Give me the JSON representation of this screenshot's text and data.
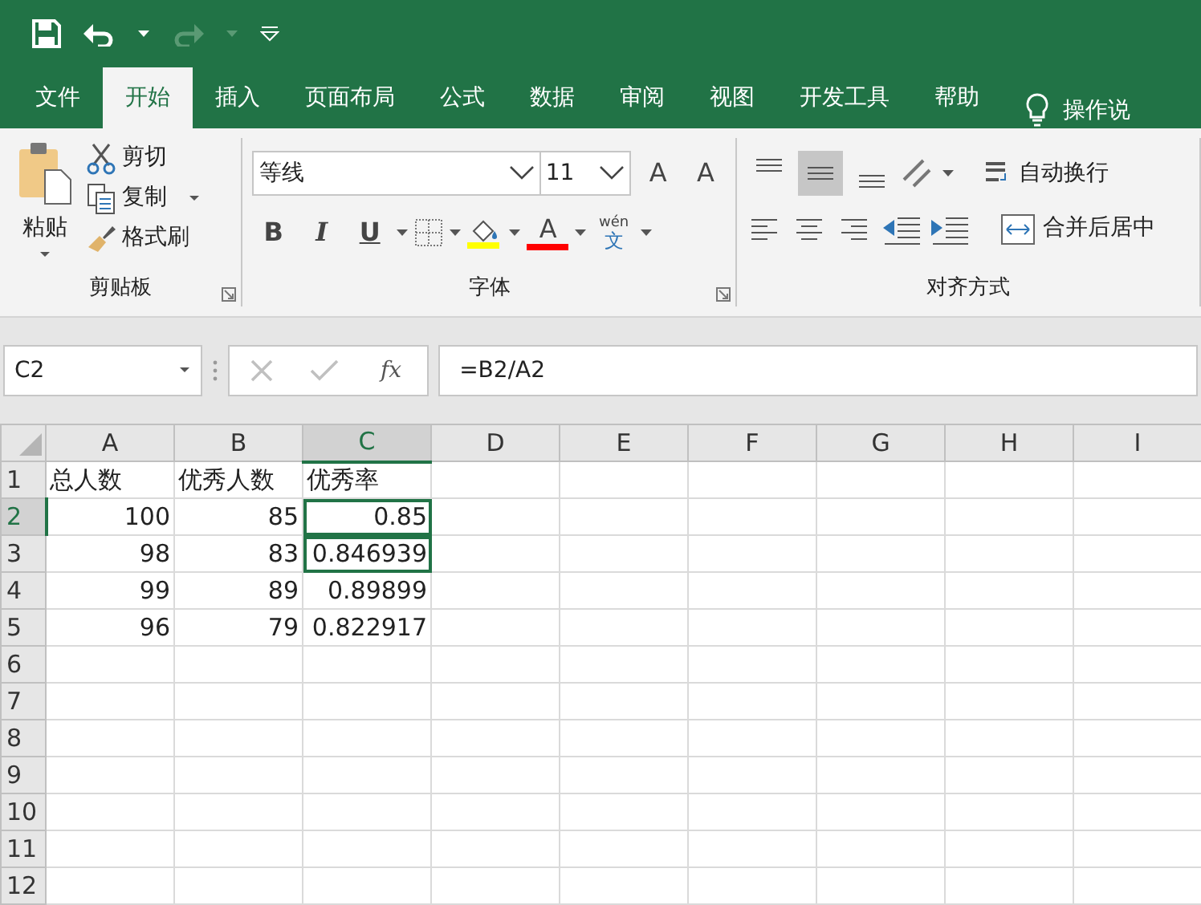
{
  "quick_access": {
    "redo_disabled": true
  },
  "tabs": [
    {
      "label": "文件",
      "selected": false
    },
    {
      "label": "开始",
      "selected": true
    },
    {
      "label": "插入",
      "selected": false
    },
    {
      "label": "页面布局",
      "selected": false
    },
    {
      "label": "公式",
      "selected": false
    },
    {
      "label": "数据",
      "selected": false
    },
    {
      "label": "审阅",
      "selected": false
    },
    {
      "label": "视图",
      "selected": false
    },
    {
      "label": "开发工具",
      "selected": false
    },
    {
      "label": "帮助",
      "selected": false
    }
  ],
  "tell_me": "操作说",
  "clipboard": {
    "paste": "粘贴",
    "cut": "剪切",
    "copy": "复制",
    "format_painter": "格式刷",
    "label": "剪贴板"
  },
  "font": {
    "name": "等线",
    "size": "11",
    "grow": "A",
    "shrink": "A",
    "bold": "B",
    "italic": "I",
    "underline": "U",
    "font_color": "A",
    "phonetic_top": "wén",
    "phonetic_bottom": "文",
    "label": "字体"
  },
  "alignment": {
    "vertical": [
      {
        "selected": false
      },
      {
        "selected": true
      },
      {
        "selected": false
      }
    ],
    "wrap": "自动换行",
    "merge": "合并后居中",
    "label": "对齐方式"
  },
  "formula_bar": {
    "name_box": "C2",
    "fx": "fx",
    "formula": "=B2/A2"
  },
  "sheet": {
    "columns": [
      {
        "label": "A",
        "selected": false
      },
      {
        "label": "B",
        "selected": false
      },
      {
        "label": "C",
        "selected": true
      },
      {
        "label": "D",
        "selected": false
      },
      {
        "label": "E",
        "selected": false
      },
      {
        "label": "F",
        "selected": false
      },
      {
        "label": "G",
        "selected": false
      },
      {
        "label": "H",
        "selected": false
      },
      {
        "label": "I",
        "selected": false
      }
    ],
    "rows": [
      {
        "label": "1",
        "selected": false,
        "cells": [
          {
            "text": "总人数",
            "kind": "text"
          },
          {
            "text": "优秀人数",
            "kind": "text"
          },
          {
            "text": "优秀率",
            "kind": "text"
          }
        ]
      },
      {
        "label": "2",
        "selected": true,
        "cells": [
          {
            "text": "100",
            "kind": "number"
          },
          {
            "text": "85",
            "kind": "number"
          },
          {
            "text": "0.85",
            "kind": "number",
            "selected": true
          }
        ]
      },
      {
        "label": "3",
        "selected": false,
        "cells": [
          {
            "text": "98",
            "kind": "number"
          },
          {
            "text": "83",
            "kind": "number"
          },
          {
            "text": "0.846939",
            "kind": "number",
            "selected": true
          }
        ]
      },
      {
        "label": "4",
        "selected": false,
        "cells": [
          {
            "text": "99",
            "kind": "number"
          },
          {
            "text": "89",
            "kind": "number"
          },
          {
            "text": "0.89899",
            "kind": "number"
          }
        ]
      },
      {
        "label": "5",
        "selected": false,
        "cells": [
          {
            "text": "96",
            "kind": "number"
          },
          {
            "text": "79",
            "kind": "number"
          },
          {
            "text": "0.822917",
            "kind": "number"
          }
        ]
      },
      {
        "label": "6",
        "selected": false,
        "cells": []
      },
      {
        "label": "7",
        "selected": false,
        "cells": []
      },
      {
        "label": "8",
        "selected": false,
        "cells": []
      },
      {
        "label": "9",
        "selected": false,
        "cells": []
      },
      {
        "label": "10",
        "selected": false,
        "cells": []
      },
      {
        "label": "11",
        "selected": false,
        "cells": []
      },
      {
        "label": "12",
        "selected": false,
        "cells": []
      }
    ]
  }
}
